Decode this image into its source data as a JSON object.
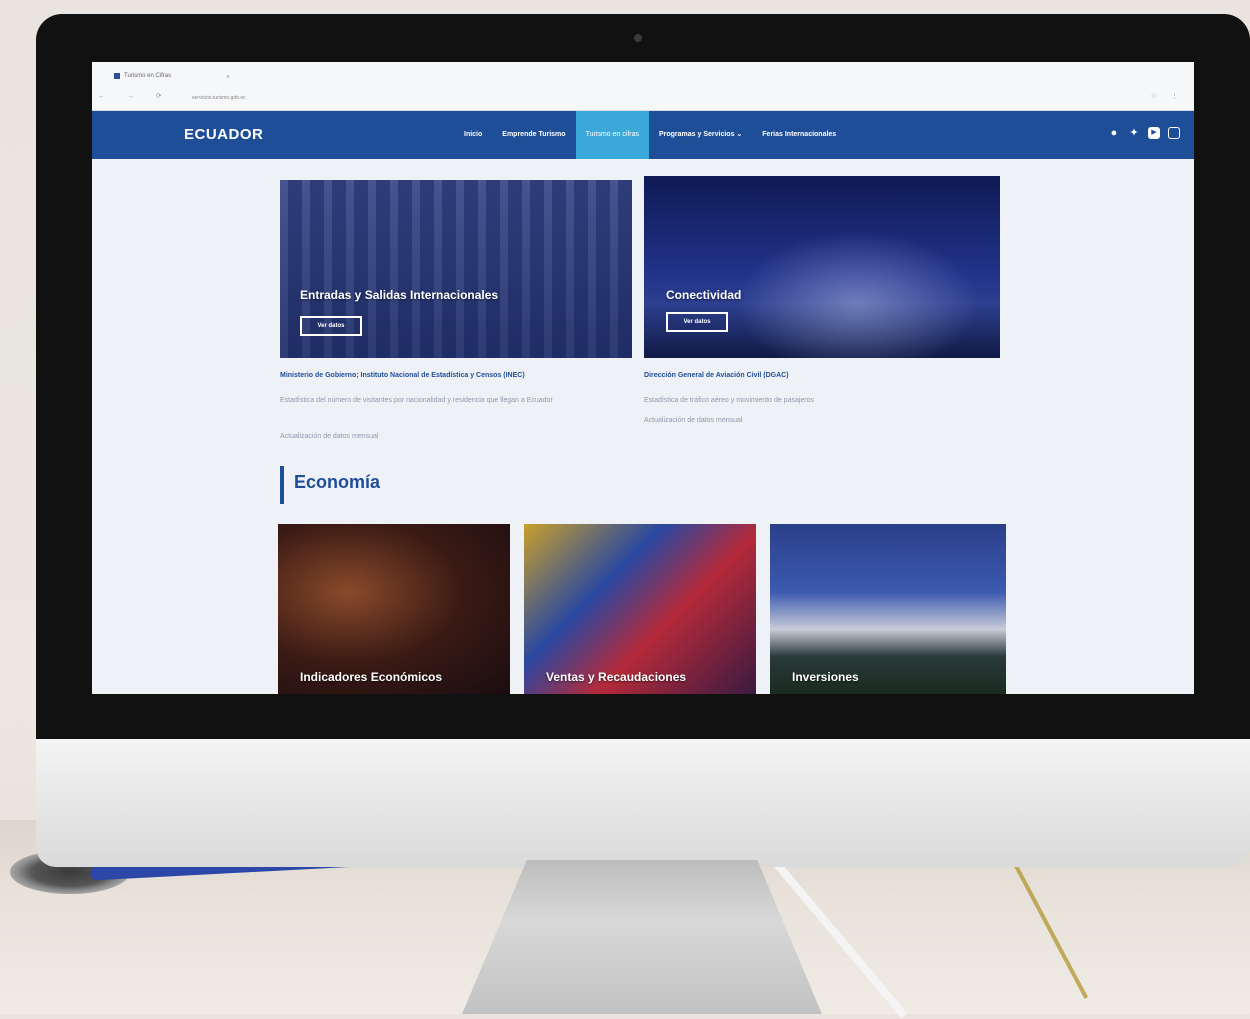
{
  "browser": {
    "tab_title": "Turismo en Cifras",
    "address": "servicios.turismo.gob.ec",
    "nav_glyphs": "← → ⟳",
    "right_glyphs": "☆ ⋮"
  },
  "site": {
    "brand": "ECUADOR",
    "menu": [
      {
        "label": "Inicio"
      },
      {
        "label": "Emprende Turismo"
      },
      {
        "label": "Turismo en cifras"
      },
      {
        "label": "Programas y Servicios ⌄"
      },
      {
        "label": "Ferias Internacionales"
      }
    ],
    "social_icons": [
      "facebook-icon",
      "twitter-icon",
      "youtube-icon",
      "instagram-icon"
    ]
  },
  "cards": [
    {
      "title": "Entradas y Salidas Internacionales",
      "button": "Ver datos",
      "source": "Ministerio de Gobierno; Instituto Nacional de Estadística y Censos (INEC)",
      "desc": "Estadística del número de visitantes por nacionalidad y residencia que llegan a Ecuador",
      "update": "Actualización de datos mensual"
    },
    {
      "title": "Conectividad",
      "button": "Ver datos",
      "source": "Dirección General de Aviación Civil (DGAC)",
      "desc": "Estadística de tráfico aéreo y movimiento de pasajeros",
      "update": "Actualización de datos mensual"
    }
  ],
  "section": {
    "title": "Economía",
    "tiles": [
      {
        "title": "Indicadores Económicos"
      },
      {
        "title": "Ventas y Recaudaciones"
      },
      {
        "title": "Inversiones"
      }
    ]
  },
  "colors": {
    "brand_blue": "#1f4e99",
    "active_tab": "#3aa9d9"
  }
}
